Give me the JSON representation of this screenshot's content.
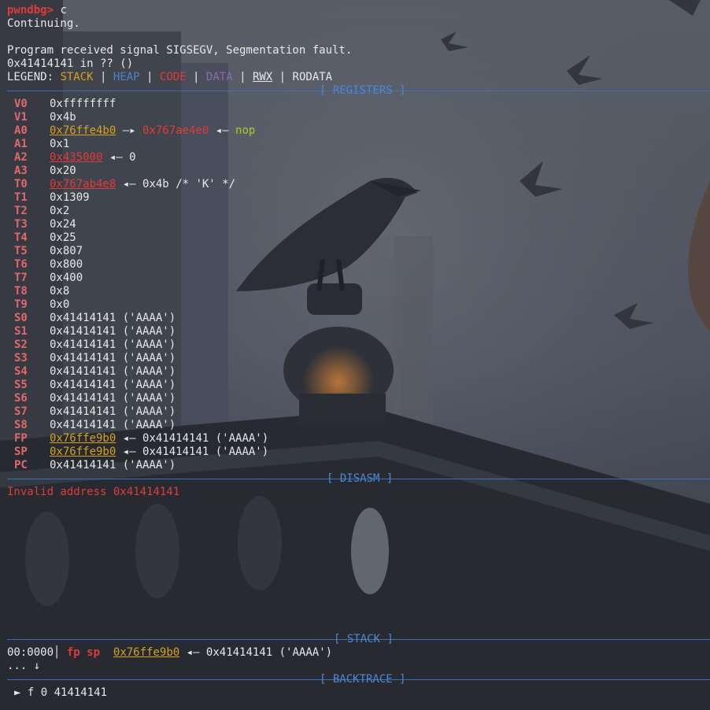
{
  "prompt": {
    "name": "pwndbg>",
    "command": " c"
  },
  "output": {
    "continuing": "Continuing.",
    "signal": "Program received signal SIGSEGV, Segmentation fault.",
    "location": "0x41414141 in ?? ()"
  },
  "legend": {
    "label": "LEGEND: ",
    "stack": "STACK",
    "heap": "HEAP",
    "code": "CODE",
    "data": "DATA",
    "rwx": "RWX",
    "rodata": "RODATA",
    "sep": " | "
  },
  "sections": {
    "registers": "[ REGISTERS ]",
    "disasm": "[ DISASM ]",
    "stack": "[ STACK ]",
    "backtrace": "[ BACKTRACE ]"
  },
  "registers": [
    {
      "name": "V0",
      "value": "0xffffffff"
    },
    {
      "name": "V1",
      "value": "0x4b"
    },
    {
      "name": "A0",
      "value": "0x76ffe4b0",
      "arrow1": " —▸ ",
      "ptr": "0x767ae4e0",
      "arrow2": " ◂— ",
      "deref": "nop"
    },
    {
      "name": "A1",
      "value": "0x1"
    },
    {
      "name": "A2",
      "value": "0x435000",
      "arrow": " ◂— ",
      "deref": "0"
    },
    {
      "name": "A3",
      "value": "0x20"
    },
    {
      "name": "T0",
      "value": "0x767ab4e8",
      "arrow": " ◂— ",
      "deref": "0x4b /* 'K' */"
    },
    {
      "name": "T1",
      "value": "0x1309"
    },
    {
      "name": "T2",
      "value": "0x2"
    },
    {
      "name": "T3",
      "value": "0x24"
    },
    {
      "name": "T4",
      "value": "0x25"
    },
    {
      "name": "T5",
      "value": "0x807"
    },
    {
      "name": "T6",
      "value": "0x800"
    },
    {
      "name": "T7",
      "value": "0x400"
    },
    {
      "name": "T8",
      "value": "0x8"
    },
    {
      "name": "T9",
      "value": "0x0"
    },
    {
      "name": "S0",
      "value": "0x41414141 ('AAAA')"
    },
    {
      "name": "S1",
      "value": "0x41414141 ('AAAA')"
    },
    {
      "name": "S2",
      "value": "0x41414141 ('AAAA')"
    },
    {
      "name": "S3",
      "value": "0x41414141 ('AAAA')"
    },
    {
      "name": "S4",
      "value": "0x41414141 ('AAAA')"
    },
    {
      "name": "S5",
      "value": "0x41414141 ('AAAA')"
    },
    {
      "name": "S6",
      "value": "0x41414141 ('AAAA')"
    },
    {
      "name": "S7",
      "value": "0x41414141 ('AAAA')"
    },
    {
      "name": "S8",
      "value": "0x41414141 ('AAAA')"
    },
    {
      "name": "FP",
      "value": "0x76ffe9b0",
      "arrow": " ◂— ",
      "deref": "0x41414141 ('AAAA')"
    },
    {
      "name": "SP",
      "value": "0x76ffe9b0",
      "arrow": " ◂— ",
      "deref": "0x41414141 ('AAAA')"
    },
    {
      "name": "PC",
      "value": "0x41414141 ('AAAA')"
    }
  ],
  "disasm": {
    "message": "Invalid address 0x41414141"
  },
  "stack": {
    "index": "00:0000",
    "bar": "│ ",
    "regs": "fp sp",
    "addr": "0x76ffe9b0",
    "arrow": " ◂— ",
    "deref": "0x41414141 ('AAAA')",
    "more": "... ↓"
  },
  "backtrace": {
    "marker": "►",
    "frame": " f 0 41414141"
  },
  "colors": {
    "prompt": "#e03b3b",
    "stack": "#d6a21e",
    "heap": "#4d82d0",
    "code": "#e03b3b",
    "data": "#8a6db0",
    "section_rule": "#3b6fb6",
    "register_name": "#e06a6a",
    "nop": "#a7cc2b"
  }
}
